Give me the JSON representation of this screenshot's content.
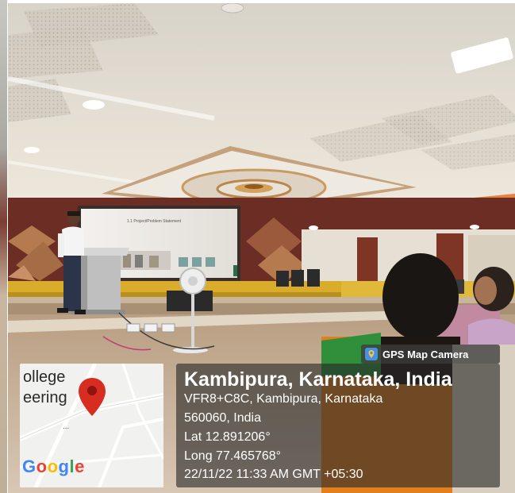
{
  "photo": {
    "slide_title": "1.1 Project/Problem Statement"
  },
  "map_card": {
    "text_line1": "ollege",
    "text_line2": "eering",
    "ellipsis": "...",
    "google_letters": [
      {
        "ch": "G",
        "color": "#4285F4"
      },
      {
        "ch": "o",
        "color": "#EA4335"
      },
      {
        "ch": "o",
        "color": "#FBBC05"
      },
      {
        "ch": "g",
        "color": "#4285F4"
      },
      {
        "ch": "l",
        "color": "#34A853"
      },
      {
        "ch": "e",
        "color": "#EA4335"
      }
    ],
    "pin_color": "#d62d20"
  },
  "badge": {
    "label": "GPS Map Camera",
    "icon": "gps-map-camera-icon"
  },
  "info": {
    "title": "Kambipura, Karnataka, India",
    "address1": "VFR8+C8C, Kambipura, Karnataka",
    "address2": "560060, India",
    "lat": "Lat 12.891206°",
    "long": "Long 77.465768°",
    "datetime": "22/11/22 11:33 AM GMT +05:30"
  }
}
